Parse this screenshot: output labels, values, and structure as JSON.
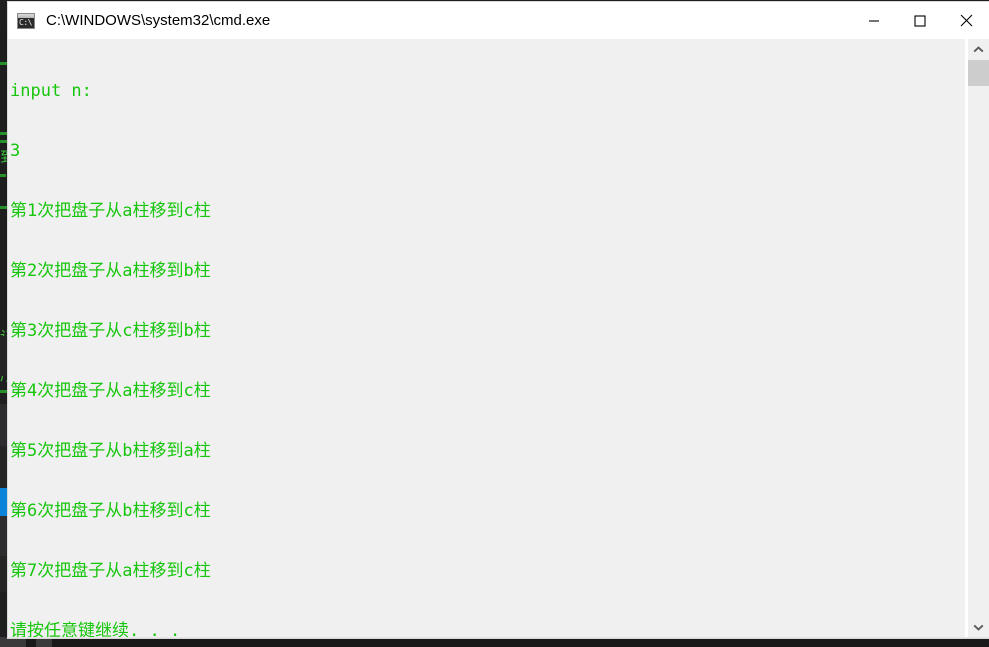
{
  "window": {
    "title": "C:\\WINDOWS\\system32\\cmd.exe",
    "app_icon": "cmd-console-icon",
    "icon_prompt_text": "C:\\",
    "buttons": {
      "minimize": {
        "name": "minimize-button",
        "label": "Minimize"
      },
      "maximize": {
        "name": "maximize-button",
        "label": "Maximize"
      },
      "close": {
        "name": "close-button",
        "label": "Close"
      }
    }
  },
  "console": {
    "foreground_color": "#16c60c",
    "background_color": "#f0f0f0",
    "lines": [
      "input n:",
      "3",
      "第1次把盘子从a柱移到c柱",
      "第2次把盘子从a柱移到b柱",
      "第3次把盘子从c柱移到b柱",
      "第4次把盘子从a柱移到c柱",
      "第5次把盘子从b柱移到a柱",
      "第6次把盘子从b柱移到c柱",
      "第7次把盘子从a柱移到c柱",
      "请按任意键继续. . ."
    ]
  },
  "scrollbar": {
    "up_arrow": "scroll-up-arrow-icon",
    "down_arrow": "scroll-down-arrow-icon",
    "thumb": "scrollbar-thumb"
  },
  "background_app": {
    "description": "dark code editor partially hidden behind console window",
    "accent_color": "#0a84d8",
    "code_color": "#3fc13f",
    "surface_color": "#1e1e1e"
  }
}
